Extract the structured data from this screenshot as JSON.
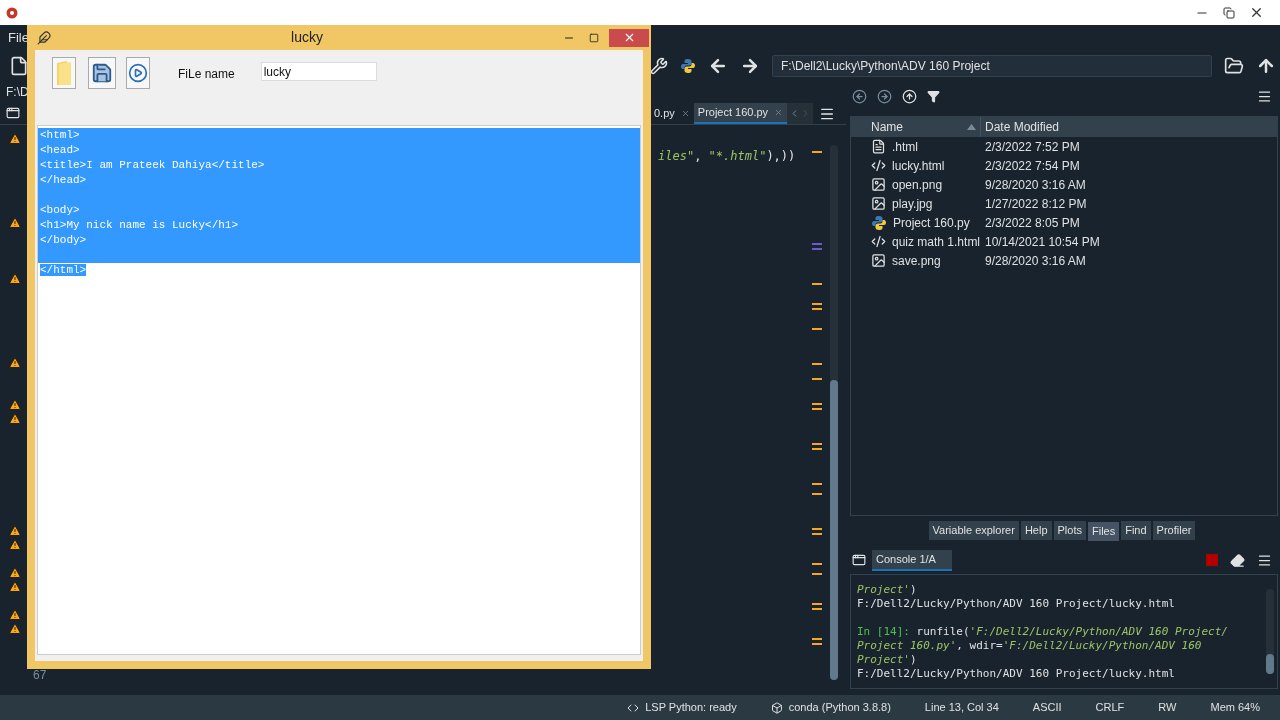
{
  "ide": {
    "menu": [
      "File"
    ],
    "path_stub": "F:\\D",
    "path": "F:\\Dell2\\Lucky\\Python\\ADV 160 Project",
    "gutter": [
      {
        "warning": true
      },
      {
        "warning": false
      },
      {
        "warning": false
      },
      {
        "warning": false
      },
      {
        "warning": false
      },
      {
        "warning": false
      },
      {
        "warning": true
      },
      {
        "warning": false
      },
      {
        "warning": false
      },
      {
        "warning": false
      },
      {
        "warning": true
      },
      {
        "warning": false
      },
      {
        "warning": false
      },
      {
        "warning": false
      },
      {
        "warning": false
      },
      {
        "warning": false
      },
      {
        "warning": true
      },
      {
        "warning": false
      },
      {
        "warning": false
      },
      {
        "warning": true
      },
      {
        "warning": true
      },
      {
        "warning": false
      },
      {
        "warning": false
      },
      {
        "warning": false
      },
      {
        "warning": false
      },
      {
        "warning": false
      },
      {
        "warning": false
      },
      {
        "warning": false
      },
      {
        "warning": true
      },
      {
        "warning": true
      },
      {
        "warning": false
      },
      {
        "warning": true
      },
      {
        "warning": true
      },
      {
        "warning": false
      },
      {
        "warning": true
      },
      {
        "warning": true
      }
    ],
    "line_number": "67",
    "editor_tabs": [
      {
        "label": "0.py",
        "selected": false
      },
      {
        "label": "Project 160.py",
        "selected": true
      }
    ],
    "code_fragment": [
      {
        "kind": "string",
        "text": "iles\""
      },
      {
        "kind": "code",
        "text": ", "
      },
      {
        "kind": "string",
        "text": "\"*.html\""
      },
      {
        "kind": "code",
        "text": "),))"
      }
    ],
    "files": {
      "columns": [
        "Name",
        "Date Modified"
      ],
      "rows": [
        {
          "name": ".html",
          "modified": "2/3/2022 7:52 PM",
          "kind": "text"
        },
        {
          "name": "lucky.html",
          "modified": "2/3/2022 7:54 PM",
          "kind": "code"
        },
        {
          "name": "open.png",
          "modified": "9/28/2020 3:16 AM",
          "kind": "image"
        },
        {
          "name": "play.jpg",
          "modified": "1/27/2022 8:12 PM",
          "kind": "image"
        },
        {
          "name": "Project 160.py",
          "modified": "2/3/2022 8:05 PM",
          "kind": "python"
        },
        {
          "name": "quiz math 1.html",
          "modified": "10/14/2021 10:54 PM",
          "kind": "code"
        },
        {
          "name": "save.png",
          "modified": "9/28/2020 3:16 AM",
          "kind": "image"
        }
      ]
    },
    "pane_tabs": [
      {
        "label": "Variable explorer",
        "selected": false
      },
      {
        "label": "Help",
        "selected": false
      },
      {
        "label": "Plots",
        "selected": false
      },
      {
        "label": "Files",
        "selected": true
      },
      {
        "label": "Find",
        "selected": false
      },
      {
        "label": "Profiler",
        "selected": false
      }
    ],
    "console": {
      "tab": "Console 1/A",
      "blocks": [
        [
          [
            {
              "kind": "string",
              "text": "Project'"
            },
            {
              "kind": "code",
              "text": ")"
            }
          ],
          [
            {
              "kind": "output",
              "text": "F:/Dell2/Lucky/Python/ADV 160 Project/lucky.html"
            }
          ]
        ],
        [
          [
            {
              "kind": "prompt",
              "text": "In [14]: "
            },
            {
              "kind": "code",
              "text": "runfile("
            },
            {
              "kind": "string",
              "text": "'F:/Dell2/Lucky/Python/ADV 160 Project/"
            }
          ],
          [
            {
              "kind": "string",
              "text": "Project 160.py'"
            },
            {
              "kind": "code",
              "text": ", wdir="
            },
            {
              "kind": "string",
              "text": "'F:/Dell2/Lucky/Python/ADV 160"
            }
          ],
          [
            {
              "kind": "string",
              "text": "Project'"
            },
            {
              "kind": "code",
              "text": ")"
            }
          ],
          [
            {
              "kind": "output",
              "text": "F:/Dell2/Lucky/Python/ADV 160 Project/lucky.html"
            }
          ]
        ]
      ]
    },
    "status": [
      {
        "kind": "lsp",
        "text": "LSP Python: ready"
      },
      {
        "kind": "env",
        "text": "conda (Python 3.8.8)"
      },
      {
        "kind": "plain",
        "text": "Line 13, Col 34"
      },
      {
        "kind": "plain",
        "text": "ASCII"
      },
      {
        "kind": "plain",
        "text": "CRLF"
      },
      {
        "kind": "plain",
        "text": "RW"
      },
      {
        "kind": "plain",
        "text": "Mem 64%"
      }
    ]
  },
  "dialog": {
    "title": "lucky",
    "file_label": "FiLe name",
    "file_value": "lucky",
    "selected": true,
    "paragraphs": [
      [
        "<html>",
        "<head>",
        "<title>I am Prateek Dahiya</title>",
        "</head>"
      ],
      [
        "<body>",
        "<h1>My nick name is Lucky</h1>",
        "</body>"
      ],
      [
        "</html>"
      ]
    ]
  }
}
